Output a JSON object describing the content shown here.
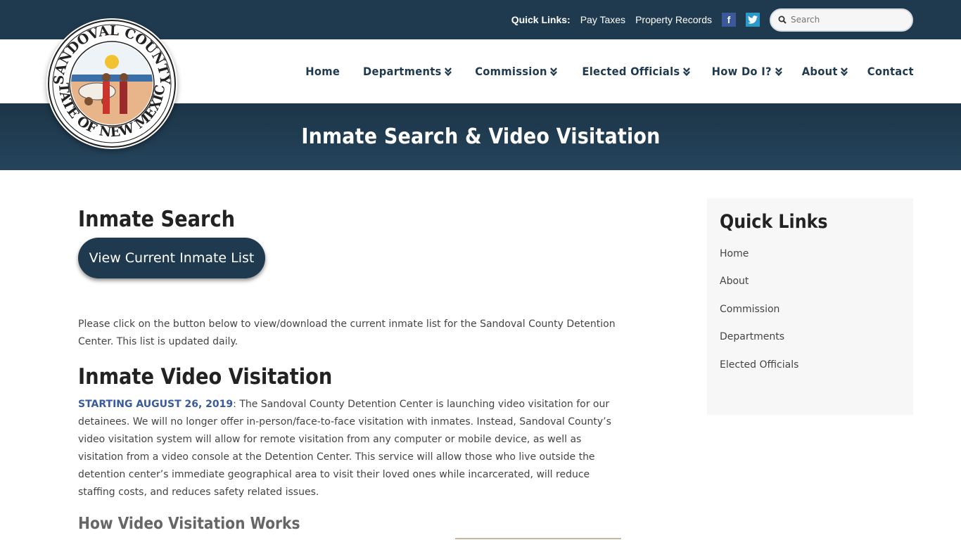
{
  "topbar": {
    "quick_links_label": "Quick Links:",
    "links": [
      "Pay Taxes",
      "Property Records"
    ],
    "facebook_glyph": "f",
    "twitter_glyph": "t",
    "search_placeholder": "Search"
  },
  "nav": {
    "items": [
      {
        "label": "Home",
        "dropdown": false
      },
      {
        "label": "Departments",
        "dropdown": true
      },
      {
        "label": "Commission",
        "dropdown": true
      },
      {
        "label": "Elected Officials",
        "dropdown": true
      },
      {
        "label": "How Do I?",
        "dropdown": true
      },
      {
        "label": "About",
        "dropdown": true
      },
      {
        "label": "Contact",
        "dropdown": false
      }
    ]
  },
  "logo": {
    "top_text": "SANDOVAL COUNTY",
    "bottom_text": "STATE OF NEW MEXICO"
  },
  "banner": {
    "title": "Inmate Search & Video Visitation"
  },
  "main": {
    "inmate_search_heading": "Inmate Search",
    "button_label": "View Current Inmate List",
    "intro_text": "Please click on the button below to view/download the current inmate list for the Sandoval County Detention Center. This list is updated daily.",
    "video_heading": "Inmate Video Visitation",
    "video_date": "STARTING AUGUST 26, 2019",
    "video_text": ": The Sandoval County Detention Center is launching video visitation for our detainees. We will no longer offer in-person/face-to-face visitation with inmates. Instead, Sandoval County’s video visitation system will allow for remote visitation from any computer or mobile device, as well as visitation from a video console at the Detention Center. This service will allow those who live outside the detention center’s immediate geographical area to visit their loved ones while incarcerated, will reduce staffing costs, and reduces safety related issues.",
    "how_heading": "How Video Visitation Works"
  },
  "sidebar": {
    "title": "Quick Links",
    "items": [
      "Home",
      "About",
      "Commission",
      "Departments",
      "Elected Officials"
    ]
  },
  "colors": {
    "navy": "#1f3a4f",
    "date_blue": "#3a5aa0",
    "facebook": "#3b5998",
    "twitter": "#2a98c8"
  }
}
